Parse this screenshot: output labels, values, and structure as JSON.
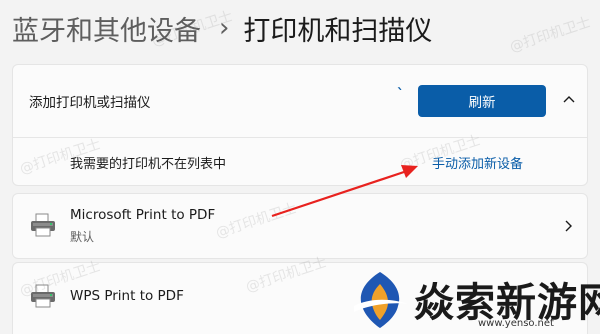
{
  "breadcrumb": {
    "parent": "蓝牙和其他设备",
    "separator": "›",
    "current": "打印机和扫描仪"
  },
  "add_printer": {
    "label": "添加打印机或扫描仪",
    "spinner": "ˋ",
    "refresh_label": "刷新",
    "missing_label": "我需要的打印机不在列表中",
    "manual_add_label": "手动添加新设备"
  },
  "printers": [
    {
      "name": "Microsoft Print to PDF",
      "status": "默认",
      "icon": "printer-icon"
    },
    {
      "name": "WPS Print to PDF",
      "status": "",
      "icon": "printer-icon"
    }
  ],
  "watermark": {
    "text": "@打印机卫士"
  },
  "logo": {
    "text": "焱索新游网",
    "url": "www.yenso.net"
  },
  "colors": {
    "accent": "#0a5da8",
    "background": "#f3f3f3",
    "card": "#fbfbfb",
    "annotation_arrow": "#e8221f"
  }
}
